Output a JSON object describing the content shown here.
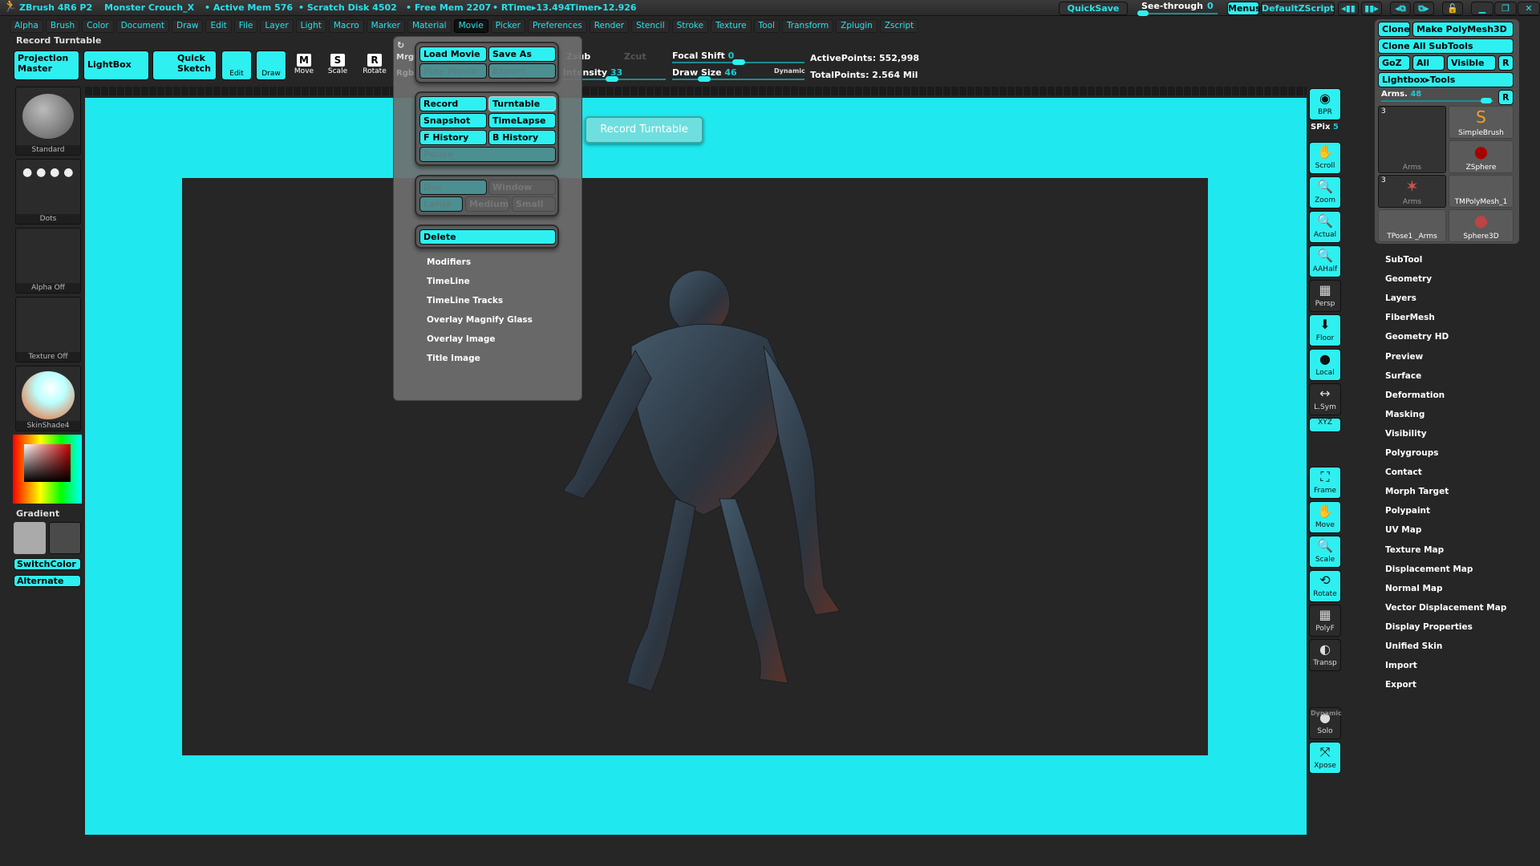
{
  "titlebar": {
    "app": "ZBrush 4R6 P2",
    "doc": "Monster Crouch_X",
    "active_mem": "• Active Mem 576",
    "scratch": "• Scratch Disk 4502",
    "free_mem": "• Free Mem 2207",
    "rtime": "• RTime▸13.494",
    "timer": "Timer▸12.926",
    "quicksave": "QuickSave",
    "see_through": "See-through",
    "see_through_value": "0",
    "menus": "Menus",
    "script": "DefaultZScript"
  },
  "menus": [
    "Alpha",
    "Brush",
    "Color",
    "Document",
    "Draw",
    "Edit",
    "File",
    "Layer",
    "Light",
    "Macro",
    "Marker",
    "Material",
    "Movie",
    "Picker",
    "Preferences",
    "Render",
    "Stencil",
    "Stroke",
    "Texture",
    "Tool",
    "Transform",
    "Zplugin",
    "Zscript"
  ],
  "active_menu": "Movie",
  "status_label": "Record Turntable",
  "toolbar": {
    "projection_master": "Projection Master",
    "lightbox": "LightBox",
    "quick_sketch": "Quick Sketch",
    "edit": "Edit",
    "draw": "Draw",
    "move": "Move",
    "scale": "Scale",
    "rotate": "Rotate",
    "mrgb": "Mrgb",
    "rgb": "Rgb",
    "zsub": "Zsub",
    "zcut": "Zcut",
    "z_intensity": "Z Intensity",
    "z_intensity_value": "33",
    "focal_shift": "Focal Shift",
    "focal_shift_value": "0",
    "draw_size": "Draw Size",
    "draw_size_value": "46",
    "dynamic": "Dynamic",
    "active_points": "ActivePoints: 552,998",
    "total_points": "TotalPoints: 2.564 Mil"
  },
  "left": {
    "brush": "Standard",
    "stroke": "Dots",
    "alpha": "Alpha Off",
    "texture": "Texture Off",
    "material": "SkinShade4",
    "gradient": "Gradient",
    "switch_color": "SwitchColor",
    "alternate": "Alternate"
  },
  "movie_menu": {
    "load_movie": "Load Movie",
    "save_as": "Save As",
    "play_movie": "Play Movie",
    "export": "Export",
    "record": "Record",
    "turntable": "Turntable",
    "snapshot": "Snapshot",
    "timelapse": "TimeLapse",
    "f_history": "F History",
    "b_history": "B History",
    "pause": "Pause",
    "doc": "Doc",
    "window": "Window",
    "large": "Large",
    "medium": "Medium",
    "small": "Small",
    "delete": "Delete",
    "sections": [
      "Modifiers",
      "TimeLine",
      "TimeLine Tracks",
      "Overlay Magnify Glass",
      "Overlay Image",
      "Title Image"
    ]
  },
  "tooltip": "Record Turntable",
  "shelf": {
    "bpr": "BPR",
    "spix": "SPix",
    "spix_value": "5",
    "items": [
      "Scroll",
      "Zoom",
      "Actual",
      "AAHalf",
      "Persp",
      "Floor",
      "Local",
      "L.Sym",
      "XYZ",
      "Frame",
      "Move",
      "Scale",
      "Rotate",
      "PolyF",
      "Transp",
      "Solo",
      "Xpose"
    ],
    "dynamic": "Dynamic"
  },
  "tool": {
    "clone": "Clone",
    "make_polymesh": "Make PolyMesh3D",
    "clone_all": "Clone All SubTools",
    "goz": "GoZ",
    "all": "All",
    "visible": "Visible",
    "r": "R",
    "lightbox_tools": "Lightbox▸Tools",
    "current": "Arms.",
    "current_value": "48",
    "tiles": [
      {
        "label": "Arms",
        "count": "3"
      },
      {
        "label": "SimpleBrush"
      },
      {
        "label": "ZSphere"
      },
      {
        "label": "Arms",
        "count": "3"
      },
      {
        "label": "TMPolyMesh_1"
      },
      {
        "label": "TPose1 _Arms"
      },
      {
        "label": "Sphere3D"
      }
    ]
  },
  "tool_sections": [
    "SubTool",
    "Geometry",
    "Layers",
    "FiberMesh",
    "Geometry HD",
    "Preview",
    "Surface",
    "Deformation",
    "Masking",
    "Visibility",
    "Polygroups",
    "Contact",
    "Morph Target",
    "Polypaint",
    "UV Map",
    "Texture Map",
    "Displacement Map",
    "Normal Map",
    "Vector Displacement Map",
    "Display Properties",
    "Unified Skin",
    "Import",
    "Export"
  ],
  "colors": {
    "accent": "#2ef0f0",
    "canvas": "#1fe9ef",
    "background": "#262626"
  }
}
